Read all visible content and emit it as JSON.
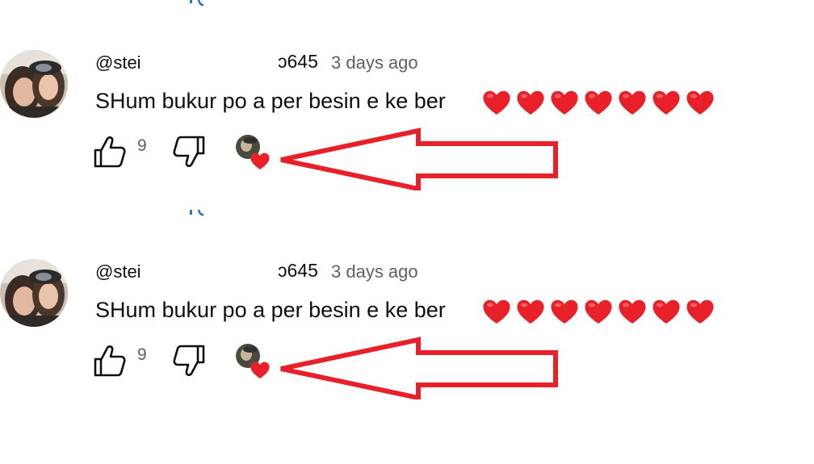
{
  "comments": [
    {
      "author_start": "@stei",
      "author_end": "ɔ645",
      "timestamp": "3 days ago",
      "text": "SHum bukur po a per besin e ke ber",
      "emojis": [
        "red-heart",
        "red-heart",
        "red-heart",
        "red-heart",
        "red-heart",
        "red-heart",
        "red-heart"
      ],
      "like_count": "9",
      "creator_heart": true
    },
    {
      "author_start": "@stei",
      "author_end": "ɔ645",
      "timestamp": "3 days ago",
      "text": "SHum bukur po a per besin e ke ber",
      "emojis": [
        "red-heart",
        "red-heart",
        "red-heart",
        "red-heart",
        "red-heart",
        "red-heart",
        "red-heart"
      ],
      "like_count": "9",
      "creator_heart": true
    }
  ],
  "colors": {
    "annotation_arrow": "#e8202a",
    "heart": "#e8202a",
    "link_fragment": "#2a6fd6",
    "text_primary": "#0f0f0f",
    "text_secondary": "#606060"
  },
  "icons": [
    "avatar",
    "like-icon",
    "dislike-icon",
    "creator-heart-icon",
    "red-heart-icon",
    "annotation-arrow"
  ]
}
